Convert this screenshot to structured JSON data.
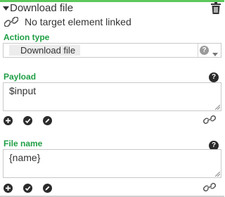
{
  "header": {
    "title": "Download file",
    "collapse_icon": "caret-down-icon",
    "delete_icon": "trash-icon"
  },
  "target": {
    "icon": "link-icon",
    "text": "No target element linked"
  },
  "action_type": {
    "label": "Action type",
    "selected": "Download file",
    "help_icon": "help-circle-icon",
    "dropdown_icon": "chevron-down-icon"
  },
  "payload": {
    "label": "Payload",
    "value": "$input",
    "help_icon": "help-circle-icon",
    "tools": [
      "add-icon",
      "check-icon",
      "edit-icon"
    ],
    "link_icon": "chain-link-icon"
  },
  "file_name": {
    "label": "File name",
    "value": "{name}",
    "help_icon": "help-circle-icon",
    "tools": [
      "add-icon",
      "check-icon",
      "edit-icon"
    ],
    "link_icon": "chain-link-icon"
  },
  "colors": {
    "accent_green": "#1f9e45",
    "top_bar": "#5cc95c",
    "dark_icon": "#2b2b2b"
  }
}
